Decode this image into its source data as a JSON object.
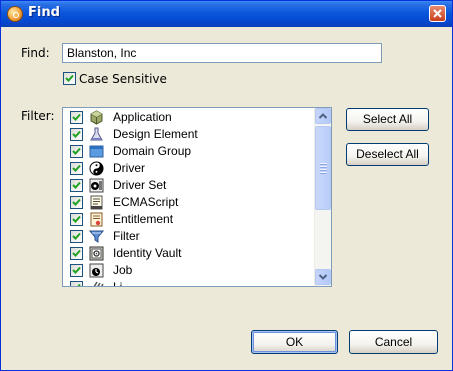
{
  "window": {
    "title": "Find"
  },
  "find": {
    "label": "Find:",
    "value": "Blanston, Inc"
  },
  "case_sensitive": {
    "label": "Case Sensitive",
    "checked": true
  },
  "filter": {
    "label": "Filter:",
    "items": [
      {
        "label": "Application",
        "icon": "cube-icon",
        "checked": true
      },
      {
        "label": "Design Element",
        "icon": "flask-icon",
        "checked": true
      },
      {
        "label": "Domain Group",
        "icon": "folder-group-icon",
        "checked": true
      },
      {
        "label": "Driver",
        "icon": "yin-yang-icon",
        "checked": true
      },
      {
        "label": "Driver Set",
        "icon": "driver-set-icon",
        "checked": true
      },
      {
        "label": "ECMAScript",
        "icon": "script-icon",
        "checked": true
      },
      {
        "label": "Entitlement",
        "icon": "certificate-icon",
        "checked": true
      },
      {
        "label": "Filter",
        "icon": "funnel-icon",
        "checked": true
      },
      {
        "label": "Identity Vault",
        "icon": "vault-icon",
        "checked": true
      },
      {
        "label": "Job",
        "icon": "job-icon",
        "checked": true
      },
      {
        "label": "Li",
        "icon": "library-icon",
        "checked": true
      }
    ]
  },
  "buttons": {
    "select_all": "Select All",
    "deselect_all": "Deselect All",
    "ok": "OK",
    "cancel": "Cancel"
  },
  "colors": {
    "titlebar": "#0a58dc",
    "face": "#ece9d8",
    "check": "#21a121"
  }
}
